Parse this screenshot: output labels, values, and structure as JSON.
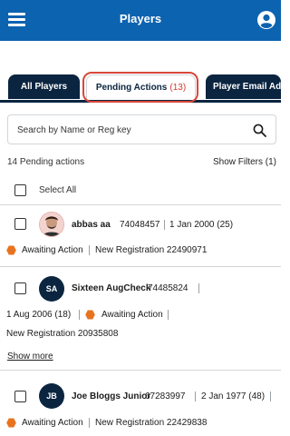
{
  "header": {
    "title": "Players",
    "menu_icon": "hamburger-menu-icon",
    "account_icon": "account-circle-icon",
    "background": "#0c63b0"
  },
  "tabs": [
    {
      "label": "All Players",
      "active": false
    },
    {
      "label": "Pending Actions",
      "count": "(13)",
      "active": true
    },
    {
      "label": "Player Email Ad",
      "active": false
    }
  ],
  "search": {
    "placeholder": "Search by Name or Reg key",
    "value": ""
  },
  "summary": {
    "pending_count": "14 Pending actions",
    "show_filters": "Show Filters (1)",
    "select_all": "Select All"
  },
  "players": [
    {
      "avatar_initials": "",
      "name": "abbas aa",
      "reg_key": "74048457",
      "dob": "1 Jan 2000 (25)",
      "status": "Awaiting Action",
      "action": "New Registration 22490971"
    },
    {
      "avatar_initials": "SA",
      "name": "Sixteen AugCheck",
      "reg_key": "74485824",
      "dob": "1 Aug 2006 (18)",
      "status": "Awaiting Action",
      "action": "New Registration 20935808",
      "show_more": "Show more"
    },
    {
      "avatar_initials": "JB",
      "name": "Joe Bloggs Junior",
      "reg_key": "67283997",
      "dob": "2 Jan 1977 (48)",
      "status": "Awaiting Action",
      "action": "New Registration 22429838"
    }
  ],
  "colors": {
    "accent": "#0c63b0",
    "dark_navy": "#0b2540",
    "status_orange": "#e8731f",
    "count_red": "#d63a2f"
  }
}
